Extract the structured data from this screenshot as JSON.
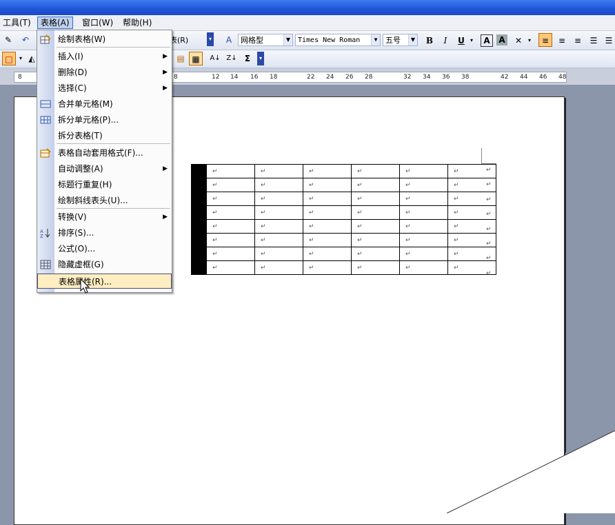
{
  "menubar": {
    "items": [
      "工具(T)",
      "表格(A)",
      "窗口(W)",
      "帮助(H)"
    ]
  },
  "toolbar": {
    "style_value": "网格型",
    "font_value": "Times New Roman",
    "size_value": "五号",
    "bold": "B",
    "italic": "I",
    "underline": "U",
    "char_border": "A",
    "char_shading": "A",
    "sum": "Σ",
    "partial_label": "表(R)"
  },
  "ruler": {
    "numbers": [
      "8",
      "8",
      "12",
      "14",
      "16",
      "18",
      "22",
      "24",
      "26",
      "28",
      "32",
      "34",
      "36",
      "38",
      "42",
      "44",
      "46",
      "48"
    ]
  },
  "dropdown": {
    "items": [
      {
        "label": "绘制表格(W)",
        "has_submenu": false,
        "icon": "pencil-table-icon"
      },
      {
        "label": "插入(I)",
        "has_submenu": true,
        "icon": ""
      },
      {
        "label": "删除(D)",
        "has_submenu": true,
        "icon": ""
      },
      {
        "label": "选择(C)",
        "has_submenu": true,
        "icon": ""
      },
      {
        "label": "合并单元格(M)",
        "has_submenu": false,
        "icon": "merge-cells-icon"
      },
      {
        "label": "拆分单元格(P)...",
        "has_submenu": false,
        "icon": "split-cells-icon"
      },
      {
        "label": "拆分表格(T)",
        "has_submenu": false,
        "icon": ""
      },
      {
        "label": "表格自动套用格式(F)...",
        "has_submenu": false,
        "icon": "autoformat-icon"
      },
      {
        "label": "自动调整(A)",
        "has_submenu": true,
        "icon": ""
      },
      {
        "label": "标题行重复(H)",
        "has_submenu": false,
        "icon": ""
      },
      {
        "label": "绘制斜线表头(U)...",
        "has_submenu": false,
        "icon": ""
      },
      {
        "label": "转换(V)",
        "has_submenu": true,
        "icon": ""
      },
      {
        "label": "排序(S)...",
        "has_submenu": false,
        "icon": "sort-icon"
      },
      {
        "label": "公式(O)...",
        "has_submenu": false,
        "icon": ""
      },
      {
        "label": "隐藏虚框(G)",
        "has_submenu": false,
        "icon": "gridlines-icon"
      },
      {
        "label": "表格属性(R)...",
        "has_submenu": false,
        "icon": ""
      }
    ]
  },
  "document": {
    "cell_mark": "↵",
    "rows": 8,
    "cols": 6
  }
}
